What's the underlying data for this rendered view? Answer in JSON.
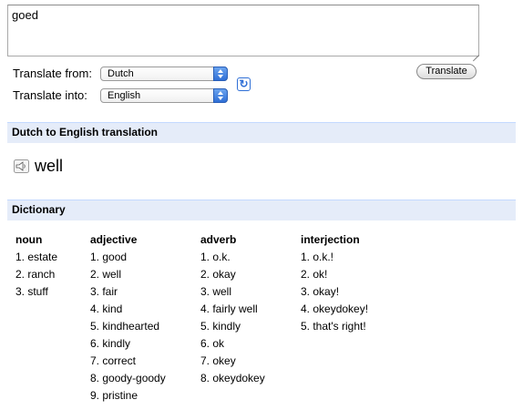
{
  "source_text": "goed",
  "labels": {
    "translate_from": "Translate from:",
    "translate_into": "Translate into:"
  },
  "from_language": "Dutch",
  "into_language": "English",
  "translate_button": "Translate",
  "translation_header": "Dutch to English translation",
  "translation_result": "well",
  "dictionary_header": "Dictionary",
  "dictionary": [
    {
      "pos": "noun",
      "entries": [
        "1. estate",
        "2. ranch",
        "3. stuff"
      ]
    },
    {
      "pos": "adjective",
      "entries": [
        "1. good",
        "2. well",
        "3. fair",
        "4. kind",
        "5. kindhearted",
        "6. kindly",
        "7. correct",
        "8. goody-goody",
        "9. pristine"
      ]
    },
    {
      "pos": "adverb",
      "entries": [
        "1. o.k.",
        "2. okay",
        "3. well",
        "4. fairly well",
        "5. kindly",
        "6. ok",
        "7. okey",
        "8. okeydokey"
      ]
    },
    {
      "pos": "interjection",
      "entries": [
        "1. o.k.!",
        "2. ok!",
        "3. okay!",
        "4. okeydokey!",
        "5. that's right!"
      ]
    }
  ],
  "icons": {
    "speaker": "speaker-icon",
    "swap": "swap-languages-icon"
  },
  "colors": {
    "section_bar": "#e5ecf9",
    "accent": "#2f6fd6"
  }
}
